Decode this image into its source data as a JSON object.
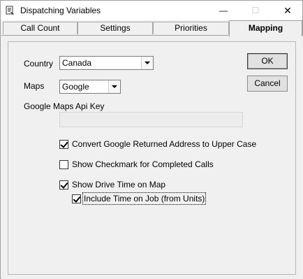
{
  "window": {
    "title": "Dispatching Variables",
    "minimize_glyph": "—",
    "maximize_glyph": "☐",
    "close_glyph": "✕"
  },
  "tabs": [
    {
      "label": "Call Count",
      "active": false
    },
    {
      "label": "Settings",
      "active": false
    },
    {
      "label": "Priorities",
      "active": false
    },
    {
      "label": "Mapping",
      "active": true
    }
  ],
  "form": {
    "country_label": "Country",
    "country_value": "Canada",
    "maps_label": "Maps",
    "maps_value": "Google",
    "api_key_label": "Google Maps Api Key",
    "api_key_value": ""
  },
  "buttons": {
    "ok": "OK",
    "cancel": "Cancel"
  },
  "options": [
    {
      "label": "Convert Google Returned Address to Upper Case",
      "checked": true
    },
    {
      "label": "Show Checkmark for Completed Calls",
      "checked": false
    },
    {
      "label": "Show Drive Time on Map",
      "checked": true
    },
    {
      "label": "Include Time on Job (from Units)",
      "checked": true
    }
  ]
}
